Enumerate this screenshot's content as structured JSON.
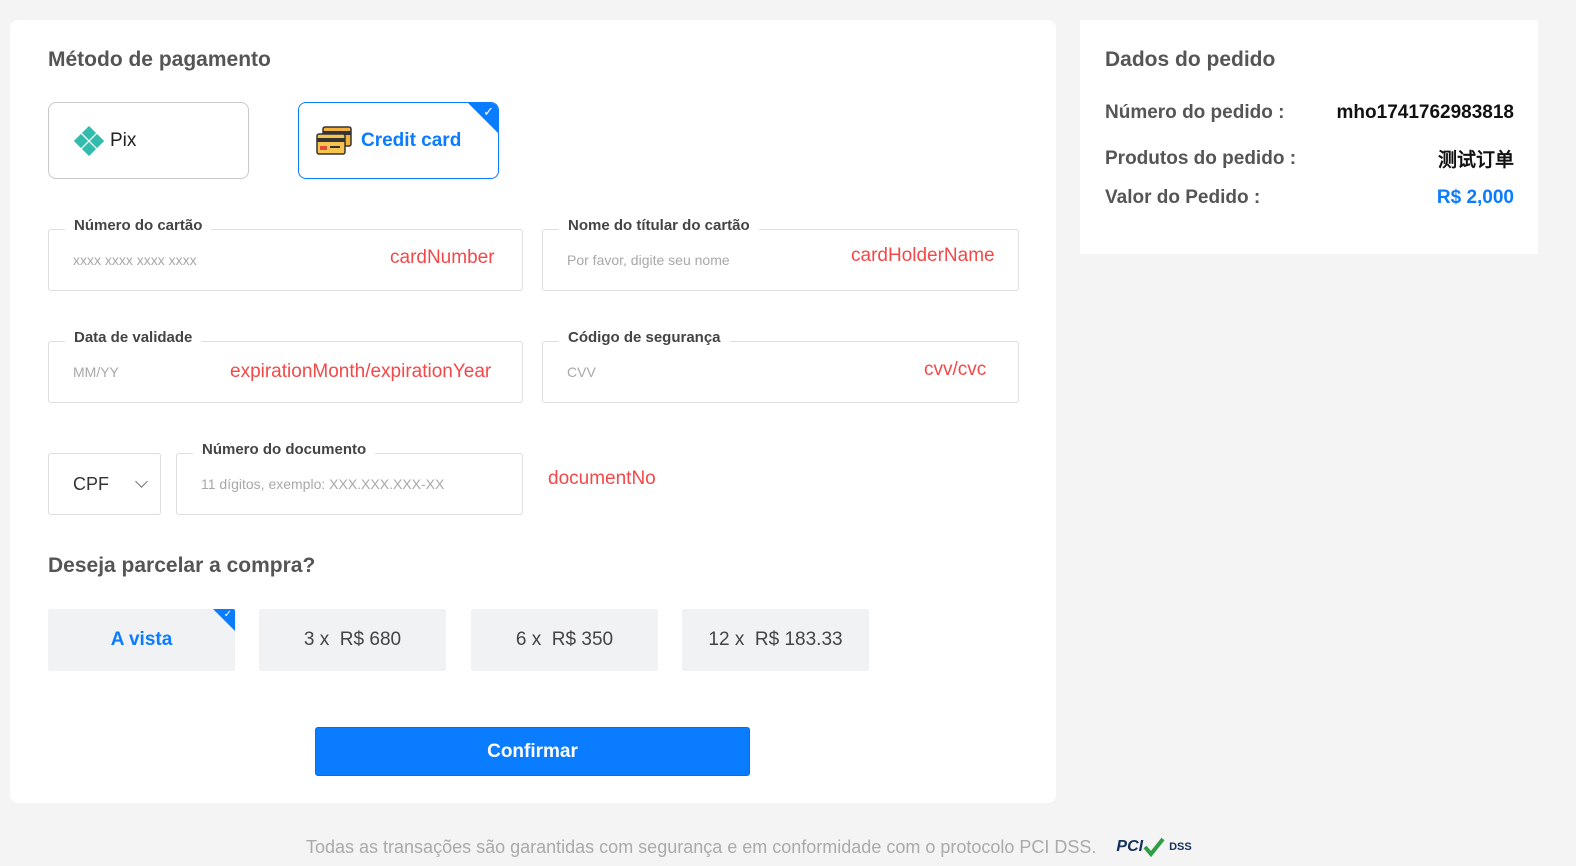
{
  "payment": {
    "title": "Método de pagamento",
    "methods": [
      {
        "label": "Pix",
        "icon": "pix-icon",
        "selected": false
      },
      {
        "label": "Credit card",
        "icon": "credit-card-icon",
        "selected": true
      }
    ],
    "fields": {
      "card_number": {
        "label": "Número do cartão",
        "placeholder": "xxxx xxxx xxxx xxxx",
        "annotation": "cardNumber"
      },
      "holder_name": {
        "label": "Nome do títular do cartão",
        "placeholder": "Por favor, digite seu nome",
        "annotation": "cardHolderName"
      },
      "expiry": {
        "label": "Data de validade",
        "placeholder": "MM/YY",
        "annotation": "expirationMonth/expirationYear"
      },
      "cvv": {
        "label": "Código de segurança",
        "placeholder": "CVV",
        "annotation": "cvv/cvc"
      },
      "document_type": {
        "value": "CPF"
      },
      "document_no": {
        "label": "Número do documento",
        "placeholder": "11 dígitos, exemplo: XXX.XXX.XXX-XX",
        "annotation": "documentNo"
      }
    },
    "installments": {
      "title": "Deseja parcelar a compra?",
      "options": [
        {
          "label": "A vista",
          "selected": true
        },
        {
          "label": "3 x  R$ 680",
          "selected": false
        },
        {
          "label": "6 x  R$ 350",
          "selected": false
        },
        {
          "label": "12 x  R$ 183.33",
          "selected": false
        }
      ]
    },
    "confirm_label": "Confirmar"
  },
  "order": {
    "title": "Dados do pedido",
    "rows": [
      {
        "key": "Número do pedido :",
        "value": "mho1741762983818"
      },
      {
        "key": "Produtos do pedido :",
        "value": "测试订单"
      },
      {
        "key": "Valor do Pedido :",
        "value": "R$ 2,000"
      }
    ]
  },
  "footer": {
    "text": "Todas as transações são garantidas com segurança e em conformidade com o protocolo PCI DSS.",
    "logo_text": "PCI",
    "logo_sub": "DSS"
  },
  "colors": {
    "accent": "#0a7cff",
    "annotation": "#f44848",
    "background": "#f4f4f5"
  }
}
